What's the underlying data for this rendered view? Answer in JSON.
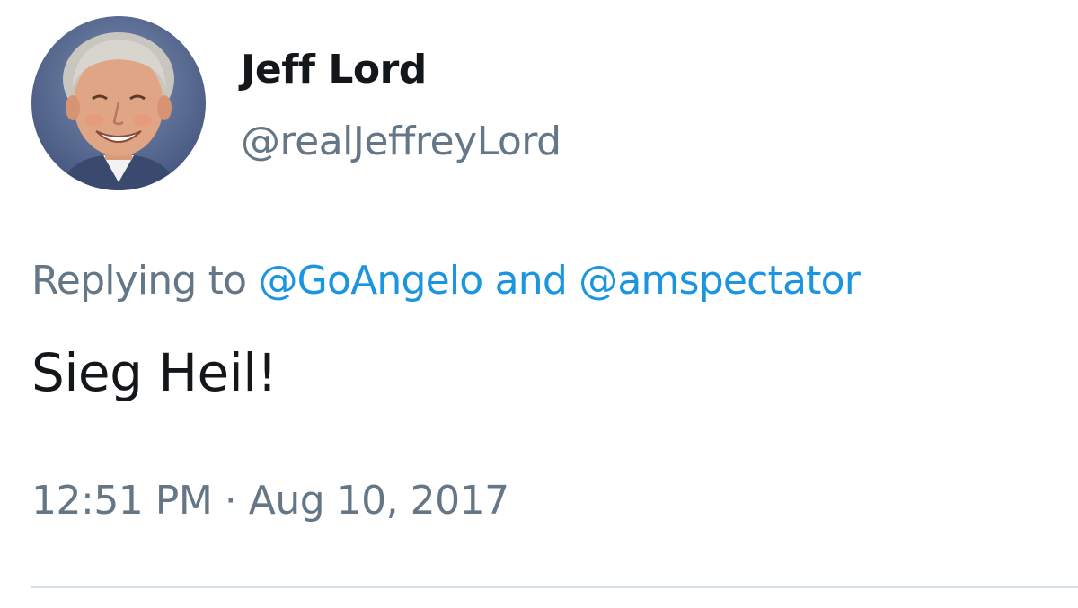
{
  "author": {
    "display_name": "Jeff Lord",
    "handle": "@realJeffreyLord",
    "avatar_icon": "user-avatar-photo"
  },
  "reply": {
    "prefix": "Replying to",
    "mention_1": "@GoAngelo",
    "conjunction": "and",
    "mention_2": "@amspectator"
  },
  "tweet": {
    "text": "Sieg Heil!",
    "timestamp": "12:51 PM · Aug 10, 2017"
  },
  "colors": {
    "text_primary": "#14171a",
    "text_secondary": "#657786",
    "link": "#1b95e0",
    "divider": "#d6e0e8"
  }
}
